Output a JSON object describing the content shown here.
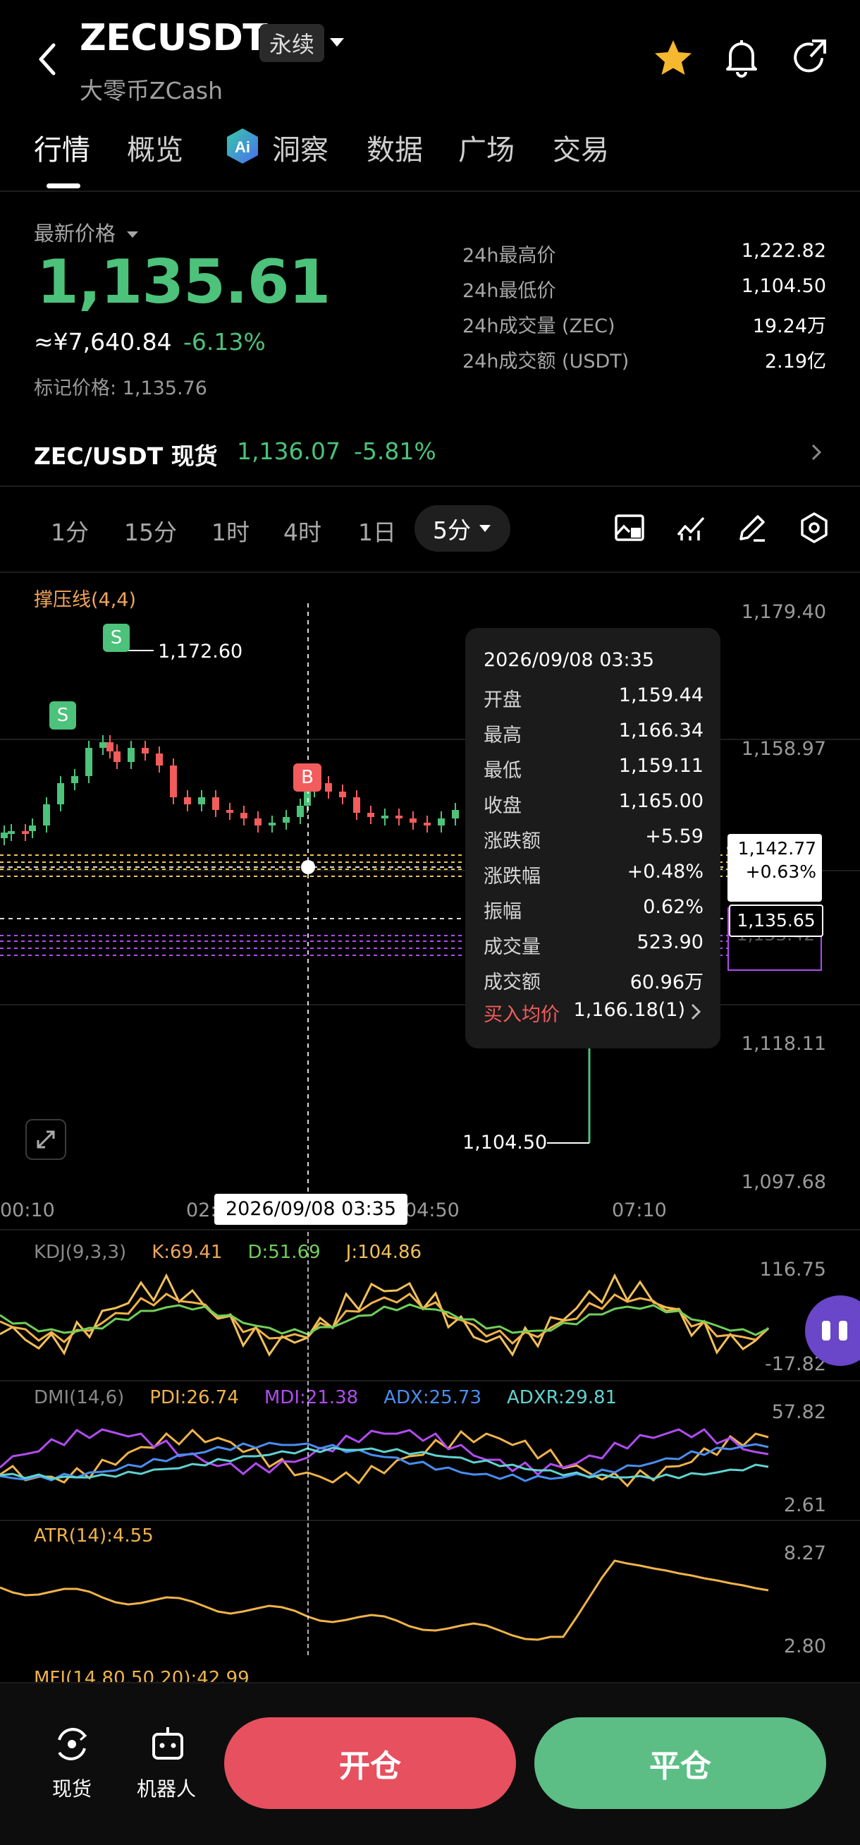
{
  "header": {
    "title": "ZECUSDT",
    "badge": "永续",
    "subtitle": "大零币ZCash"
  },
  "tabs": [
    {
      "label": "行情"
    },
    {
      "label": "概览"
    },
    {
      "label": "洞察"
    },
    {
      "label": "数据"
    },
    {
      "label": "广场"
    },
    {
      "label": "交易"
    }
  ],
  "price": {
    "latest_label": "最新价格",
    "last": "1,135.61",
    "cny": "≈¥7,640.84",
    "change_pct": "-6.13%",
    "mark_label": "标记价格: 1,135.76"
  },
  "stats": [
    {
      "label": "24h最高价",
      "value": "1,222.82"
    },
    {
      "label": "24h最低价",
      "value": "1,104.50"
    },
    {
      "label": "24h成交量 (ZEC)",
      "value": "19.24万"
    },
    {
      "label": "24h成交额 (USDT)",
      "value": "2.19亿"
    }
  ],
  "spot": {
    "label": "ZEC/USDT 现货",
    "price": "1,136.07",
    "change": "-5.81%"
  },
  "intervals": [
    "1分",
    "15分",
    "1时",
    "4时",
    "1日"
  ],
  "interval_selected": "5分",
  "chart": {
    "indicator_label": "撑压线(4,4)",
    "price_axis": [
      "1,179.40",
      "1,158.97",
      "1,118.11",
      "1,097.68"
    ],
    "time_axis": [
      "00:10",
      "02:",
      "04:50",
      "07:10"
    ],
    "high_marker": "1,172.60",
    "low_marker": "1,104.50",
    "crosshair_time": "2026/09/08 03:35",
    "right_price_tag": "1,142.77",
    "right_pct_tag": "+0.63%",
    "current_price_tag": "1,135.65",
    "hidden_tag": "1,133.42",
    "markers": {
      "sell": "S",
      "buy": "B"
    }
  },
  "tooltip": {
    "date": "2026/09/08 03:35",
    "rows": [
      {
        "label": "开盘",
        "value": "1,159.44"
      },
      {
        "label": "最高",
        "value": "1,166.34"
      },
      {
        "label": "最低",
        "value": "1,159.11"
      },
      {
        "label": "收盘",
        "value": "1,165.00"
      },
      {
        "label": "涨跌额",
        "value": "+5.59"
      },
      {
        "label": "涨跌幅",
        "value": "+0.48%"
      },
      {
        "label": "振幅",
        "value": "0.62%"
      },
      {
        "label": "成交量",
        "value": "523.90"
      },
      {
        "label": "成交额",
        "value": "60.96万"
      }
    ],
    "buy_avg_label": "买入均价",
    "buy_avg_value": "1,166.18(1)"
  },
  "indicators": {
    "kdj": {
      "name": "KDJ(9,3,3)",
      "k": "K:69.41",
      "d": "D:51.69",
      "j": "J:104.86",
      "max": "116.75",
      "min": "-17.82"
    },
    "dmi": {
      "name": "DMI(14,6)",
      "pdi": "PDI:26.74",
      "mdi": "MDI:21.38",
      "adx": "ADX:25.73",
      "adxr": "ADXR:29.81",
      "max": "57.82",
      "min": "2.61"
    },
    "atr": {
      "name": "ATR(14):4.55",
      "max": "8.27",
      "min": "2.80"
    },
    "mfi": {
      "name": "MFI(14,80,50,20):42.99"
    }
  },
  "colors": {
    "up": "#4cc27a",
    "down": "#f25c5c",
    "kdj_k": "#f0b34a",
    "kdj_d": "#6fcf5a",
    "kdj_j": "#f2c05a",
    "dmi_pdi": "#f0b34a",
    "dmi_mdi": "#b14cf0",
    "dmi_adx": "#4a8ef0",
    "dmi_adxr": "#5fd3d0",
    "atr": "#f0b34a",
    "support": "#f2c94c",
    "resistance": "#b14cf0"
  },
  "bottom": {
    "spot_label": "现货",
    "bot_label": "机器人",
    "open_label": "开仓",
    "close_label": "平仓"
  }
}
